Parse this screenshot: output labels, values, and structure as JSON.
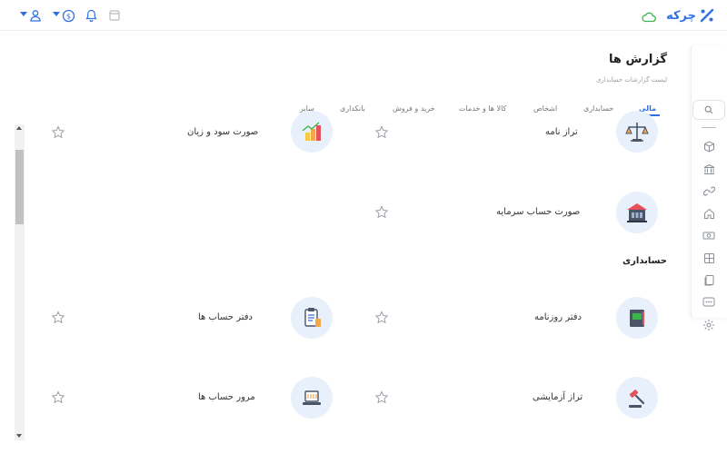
{
  "app": {
    "brand_name": "چرکه"
  },
  "header": {
    "title": "گزارش ها",
    "subtitle": "لیست گزارشات حسابداری"
  },
  "tabs": [
    {
      "label": "مالی",
      "active": true
    },
    {
      "label": "حسابداری",
      "active": false
    },
    {
      "label": "اشخاص",
      "active": false
    },
    {
      "label": "کالا ها و خدمات",
      "active": false
    },
    {
      "label": "خرید و فروش",
      "active": false
    },
    {
      "label": "بانکداری",
      "active": false
    },
    {
      "label": "سایر",
      "active": false
    }
  ],
  "financial_reports": [
    {
      "title": "تراز نامه",
      "icon": "balance-scale-icon"
    },
    {
      "title": "صورت سود و زیان",
      "icon": "profit-chart-icon"
    },
    {
      "title": "صورت حساب سرمایه",
      "icon": "capital-bank-icon"
    }
  ],
  "accounting_section": {
    "title": "حسابداری",
    "reports": [
      {
        "title": "دفتر روزنامه",
        "icon": "journal-book-icon"
      },
      {
        "title": "دفتر حساب ها",
        "icon": "clipboard-ledger-icon"
      },
      {
        "title": "تراز آزمایشی",
        "icon": "gavel-icon"
      },
      {
        "title": "مرور حساب ها",
        "icon": "laptop-icon"
      }
    ]
  },
  "colors": {
    "accent": "#2f6fe4",
    "success": "#3bb54a",
    "icon_bg": "#e8f0fb"
  }
}
